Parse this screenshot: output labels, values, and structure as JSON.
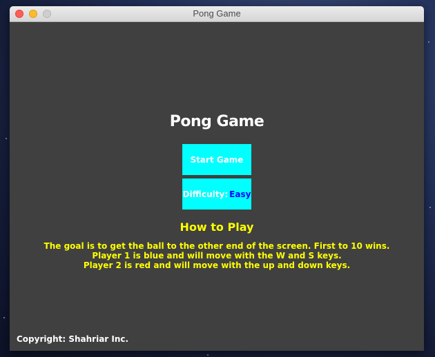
{
  "window": {
    "title": "Pong Game"
  },
  "menu": {
    "heading": "Pong Game",
    "start_button": "Start Game",
    "difficulty_label": "Difficulty:",
    "difficulty_value": "Easy"
  },
  "how_to_play": {
    "title": "How to Play",
    "lines": [
      "The goal is to get the ball to the other end of the screen. First to 10 wins.",
      "Player 1 is blue and will move with the W and S keys.",
      "Player 2 is red and will move with the up and down keys."
    ]
  },
  "footer": {
    "copyright": "Copyright: Shahriar Inc."
  },
  "colors": {
    "background": "#404040",
    "button_bg": "#00ffff",
    "instructions": "#ffff00",
    "difficulty_value": "#0000ff"
  }
}
